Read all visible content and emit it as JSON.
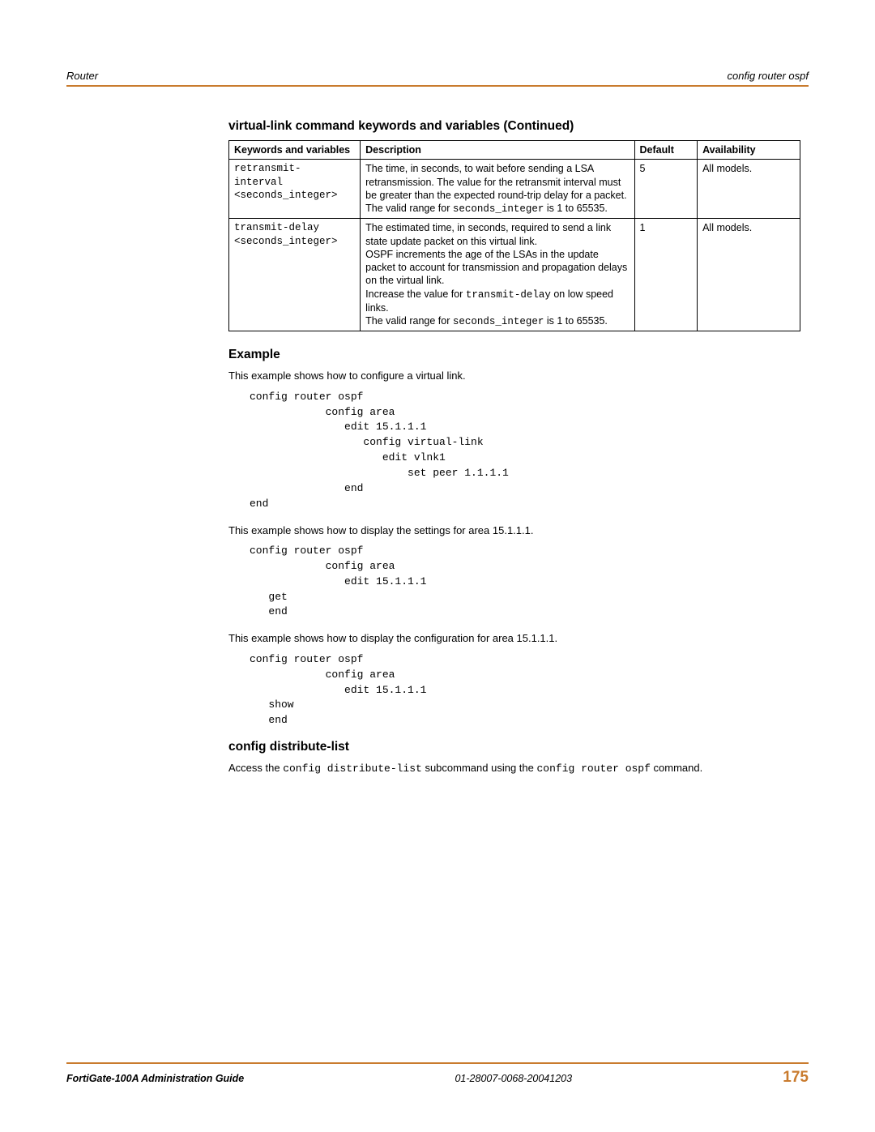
{
  "header": {
    "left": "Router",
    "right": "config router ospf"
  },
  "table": {
    "title": "virtual-link command keywords and variables (Continued)",
    "headers": {
      "kw": "Keywords and variables",
      "desc": "Description",
      "def": "Default",
      "avail": "Availability"
    },
    "rows": [
      {
        "kw": "retransmit-\ninterval\n<seconds_integer>",
        "desc_pre": "The time, in seconds, to wait before sending a LSA retransmission. The value for the retransmit interval must be greater than the expected round-trip delay for a packet. The valid range for ",
        "desc_mono": "seconds_integer",
        "desc_post": " is 1 to 65535.",
        "def": "5",
        "avail": "All models."
      },
      {
        "kw": "transmit-delay\n<seconds_integer>",
        "p1": "The estimated time, in seconds, required to send a link state update packet on this virtual link.",
        "p2": "OSPF increments the age of the LSAs in the update packet to account for transmission and propagation delays on the virtual link.",
        "p3_pre": "Increase the value for ",
        "p3_mono": "transmit-delay",
        "p3_post": " on low speed links.",
        "p4_pre": "The valid range for ",
        "p4_mono": "seconds_integer",
        "p4_post": " is 1 to 65535.",
        "def": "1",
        "avail": "All models."
      }
    ]
  },
  "example": {
    "heading": "Example",
    "intro1": "This example shows how to configure a virtual link.",
    "code1": "config router ospf\n            config area\n               edit 15.1.1.1\n                  config virtual-link\n                     edit vlnk1\n                         set peer 1.1.1.1\n               end\nend",
    "intro2": "This example shows how to display the settings for area 15.1.1.1.",
    "code2": "config router ospf\n            config area\n               edit 15.1.1.1\n   get\n   end",
    "intro3": "This example shows how to display the configuration for area 15.1.1.1.",
    "code3": "config router ospf\n            config area\n               edit 15.1.1.1\n   show\n   end"
  },
  "distlist": {
    "heading": "config distribute-list",
    "p_pre": "Access the ",
    "p_mono1": "config distribute-list",
    "p_mid": " subcommand using the ",
    "p_mono2": "config router ospf",
    "p_post": " command."
  },
  "footer": {
    "left": "FortiGate-100A Administration Guide",
    "mid": "01-28007-0068-20041203",
    "page": "175"
  }
}
